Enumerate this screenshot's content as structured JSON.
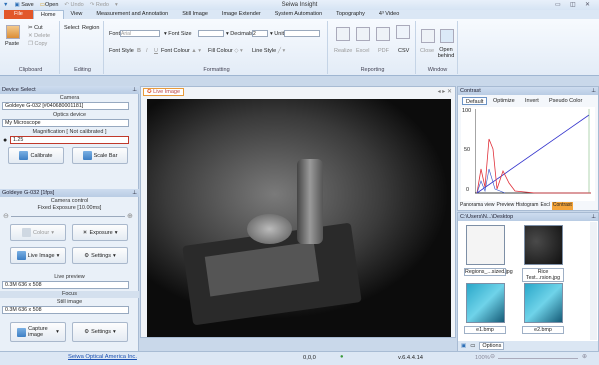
{
  "qat": {
    "save": "Save",
    "open": "Open",
    "undo": "Undo",
    "redo": "Redo",
    "title": "Seiwa Insight"
  },
  "tabs": [
    "File",
    "Home",
    "View",
    "Measurement and Annotation",
    "Still Image",
    "Image Extender",
    "System Automation",
    "Topography",
    "4³ Video"
  ],
  "ribbon": {
    "clipboard": {
      "paste": "Paste",
      "cut": "Cut",
      "delete": "Delete",
      "copy": "Copy",
      "label": "Clipboard"
    },
    "editing": {
      "select": "Select",
      "region": "Region",
      "label": "Editing"
    },
    "formatting": {
      "font": "Font",
      "font_value": "Arial",
      "font_size": "Font Size",
      "decimals": "Decimals",
      "decimals_value": "2",
      "unit": "Unit",
      "font_style": "Font Style",
      "bold": "B",
      "italic": "I",
      "underline": "U",
      "font_colour": "Font Colour",
      "fill_colour": "Fill Colour",
      "line_style": "Line Style",
      "label": "Formatting"
    },
    "reporting": {
      "realize": "Realize",
      "excel": "Excel",
      "pdf": "PDF",
      "csv": "CSV",
      "label": "Reporting"
    },
    "window": {
      "close": "Close",
      "open_behind": "Open behind",
      "label": "Window"
    }
  },
  "left": {
    "device_header": "Device Select",
    "camera_section": "Camera",
    "camera_value": "Goldeye G-032  [#040680001181]",
    "optics_section": "Optics device",
    "optics_value": "My Microscope",
    "magnif_section": "Magnification  [ Not calibrated ]",
    "magnif_value": "1.25",
    "calibrate": "Calibrate",
    "scalebar": "Scale Bar",
    "cam_header": "Goldeye G-032  [1fps]",
    "camctrl_section": "Camera control",
    "exposure_text": "Fixed Exposure [10.00ms]",
    "colour": "Colour",
    "exposure": "Exposure",
    "live_image": "Live Image",
    "settings": "Settings",
    "preview_section": "Live preview",
    "preview_value": "0.3M 636 x 508",
    "focus": "Focus",
    "still_section": "Still image",
    "still_value": "0.3M 636 x 508",
    "capture": "Capture image",
    "settings2": "Settings"
  },
  "doc": {
    "tab": "Live Image"
  },
  "contrast": {
    "header": "Contrast",
    "buttons": [
      "Default",
      "Optimize",
      "Invert",
      "Pseudo Color"
    ],
    "yticks": [
      "100",
      "50",
      "0"
    ],
    "bottom_tabs": [
      "Panorama view",
      "Preview Histogram",
      "Excl",
      "Contrast"
    ]
  },
  "files": {
    "path": "C:\\Users\\N...\\Desktop",
    "thumbs": [
      "Regions_...sized.jpg",
      "Rice Test...rsion.jpg",
      "e1.bmp",
      "e2.bmp"
    ],
    "options": "Options"
  },
  "status": {
    "company": "Seiwa Optical America Inc.",
    "coord": "0,0,0",
    "version": "v.6.4.4.14",
    "zoom": "100%"
  }
}
